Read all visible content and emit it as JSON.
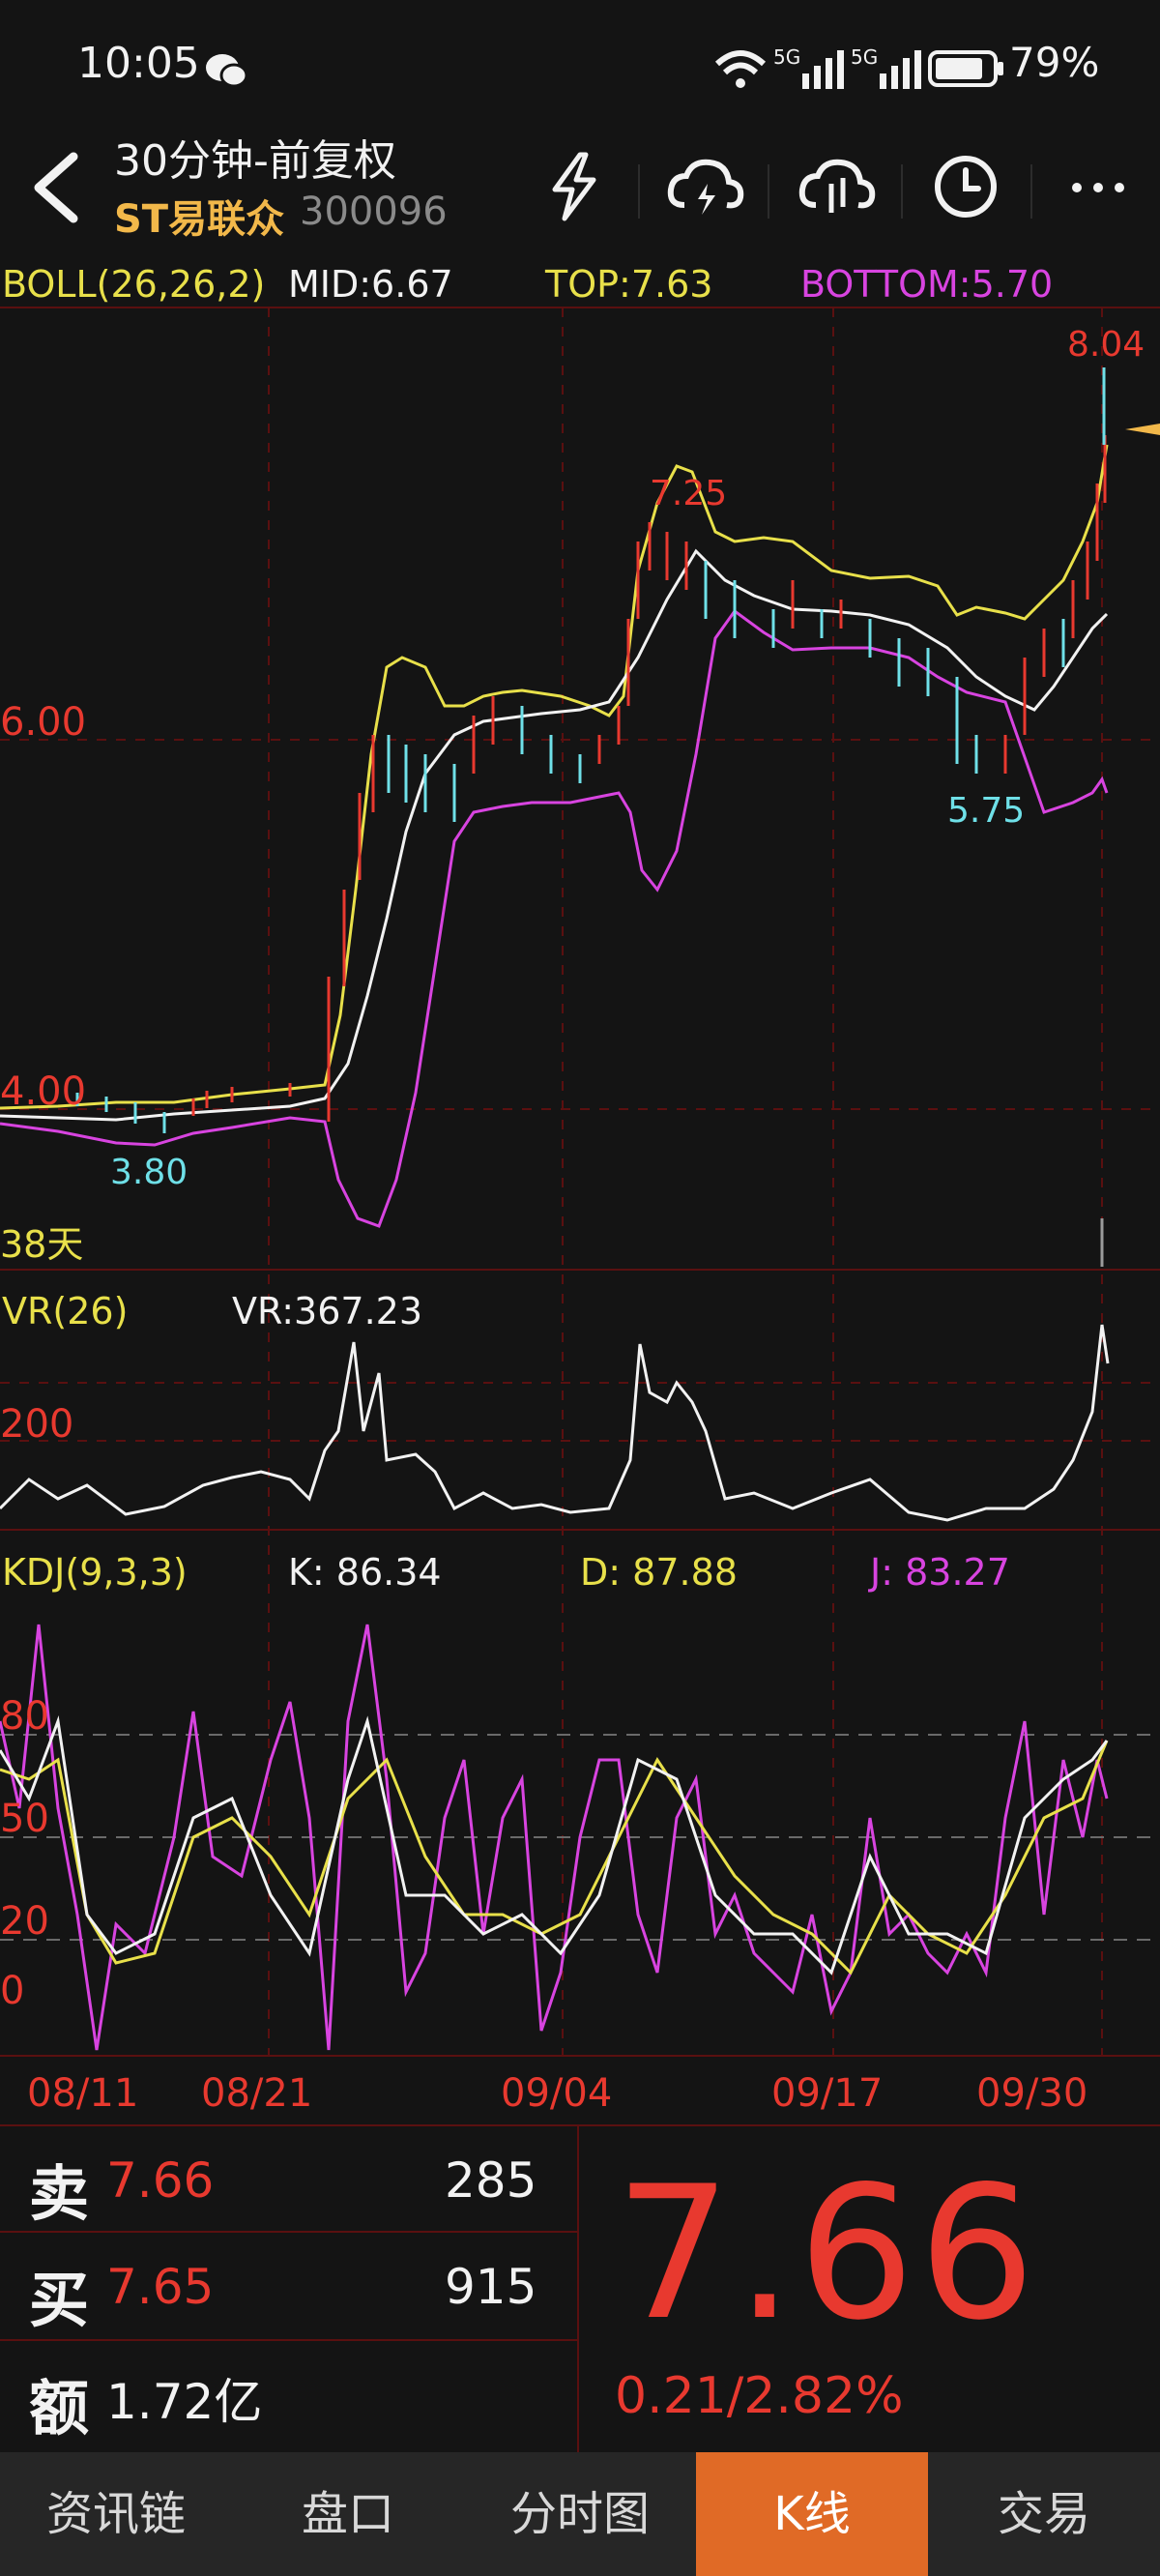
{
  "status": {
    "time": "10:05",
    "battery": "79%",
    "network1": "5G",
    "network2": "5G"
  },
  "header": {
    "title": "30分钟-前复权",
    "stock_name": "ST易联众",
    "stock_code": "300096"
  },
  "boll": {
    "label": "BOLL(26,26,2)",
    "mid": "MID:6.67",
    "top": "TOP:7.63",
    "bottom": "BOTTOM:5.70",
    "axis_6": "6.00",
    "axis_4": "4.00",
    "high": "8.04",
    "high2": "7.25",
    "low": "5.75",
    "low2": "3.80",
    "days": "38天"
  },
  "vr": {
    "label": "VR(26)",
    "value": "VR:367.23",
    "axis_200": "200"
  },
  "kdj": {
    "label": "KDJ(9,3,3)",
    "k": "K: 86.34",
    "d": "D: 87.88",
    "j": "J: 83.27",
    "axis_80": "80",
    "axis_50": "50",
    "axis_20": "20",
    "axis_0": "0"
  },
  "dates": [
    "08/11",
    "08/21",
    "09/04",
    "09/17",
    "09/30"
  ],
  "quote": {
    "sell_char": "卖",
    "sell_price": "7.66",
    "sell_vol": "285",
    "buy_char": "买",
    "buy_price": "7.65",
    "buy_vol": "915",
    "amount_char": "额",
    "amount": "1.72亿",
    "price": "7.66",
    "change": "0.21/2.82%"
  },
  "tabs": [
    {
      "label": "资讯链",
      "active": false
    },
    {
      "label": "盘口",
      "active": false
    },
    {
      "label": "分时图",
      "active": false
    },
    {
      "label": "K线",
      "active": true
    },
    {
      "label": "交易",
      "active": false
    }
  ],
  "colors": {
    "up": "#e8392f",
    "down": "#6fe0e8",
    "boll_top": "#e8e04a",
    "boll_mid": "#ffffff",
    "boll_bottom": "#d844e0",
    "accent": "#e06a26"
  }
}
